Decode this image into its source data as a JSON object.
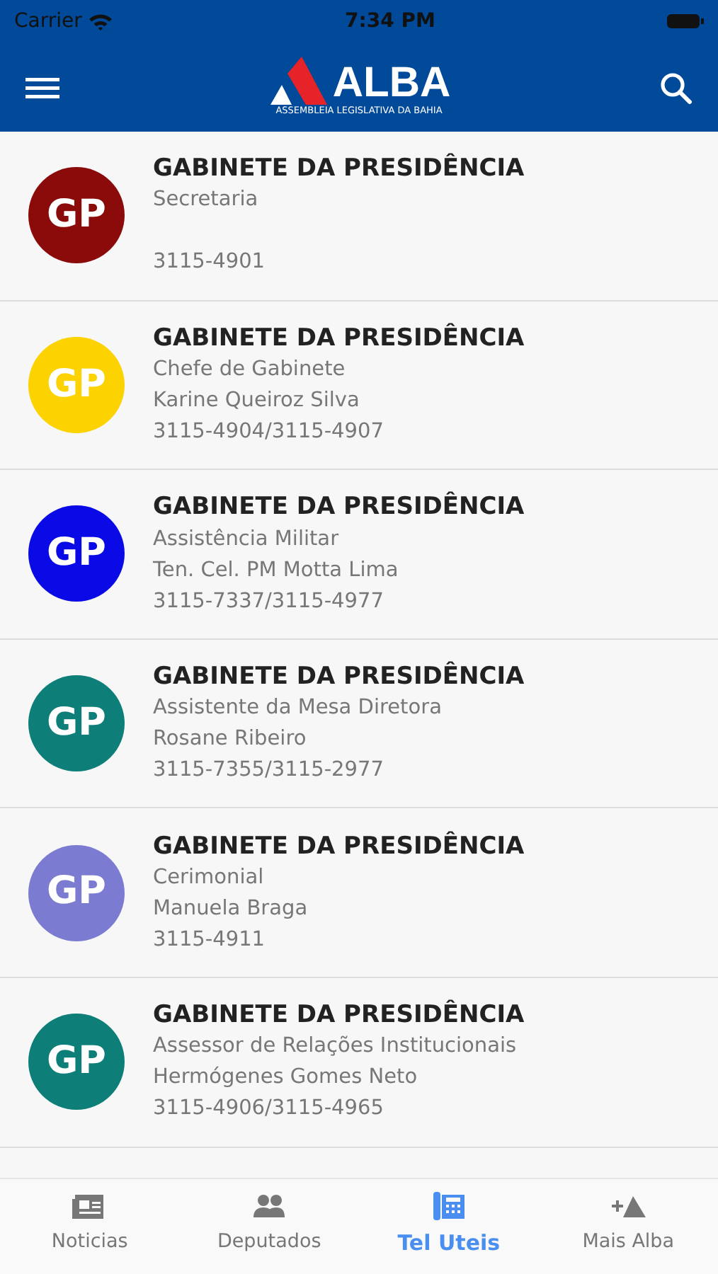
{
  "status_bar": {
    "carrier": "Carrier",
    "time": "7:34 PM"
  },
  "header": {
    "logo_text": "ALBA",
    "logo_subtitle": "ASSEMBLEIA LEGISLATIVA DA BAHIA"
  },
  "contacts": [
    {
      "initials": "GP",
      "color": "#8b0a0a",
      "title": "GABINETE DA PRESIDÊNCIA",
      "department": "Secretaria",
      "phone": "3115-4901"
    },
    {
      "initials": "GP",
      "color": "#fcd200",
      "title": "GABINETE DA PRESIDÊNCIA",
      "department": "Chefe de Gabinete",
      "person": "Karine Queiroz Silva",
      "phone": "3115-4904/3115-4907"
    },
    {
      "initials": "GP",
      "color": "#0a0ae6",
      "title": "GABINETE DA PRESIDÊNCIA",
      "department": "Assistência Militar",
      "person": "Ten. Cel. PM Motta Lima",
      "phone": "3115-7337/3115-4977"
    },
    {
      "initials": "GP",
      "color": "#0e7f78",
      "title": "GABINETE DA PRESIDÊNCIA",
      "department": "Assistente da Mesa Diretora",
      "person": "Rosane Ribeiro",
      "phone": "3115-7355/3115-2977"
    },
    {
      "initials": "GP",
      "color": "#7b7bd2",
      "title": "GABINETE DA PRESIDÊNCIA",
      "department": "Cerimonial",
      "person": "Manuela Braga",
      "phone": "3115-4911"
    },
    {
      "initials": "GP",
      "color": "#0e7f78",
      "title": "GABINETE DA PRESIDÊNCIA",
      "department": "Assessor de Relações Institucionais",
      "person": "Hermógenes Gomes Neto",
      "phone": "3115-4906/3115-4965"
    }
  ],
  "tabs": [
    {
      "kind": "news",
      "label": "Noticias",
      "selected": false
    },
    {
      "kind": "people",
      "label": "Deputados",
      "selected": false
    },
    {
      "kind": "phone",
      "label": "Tel Uteis",
      "selected": true
    },
    {
      "kind": "more",
      "label": "Mais Alba",
      "selected": false
    }
  ]
}
